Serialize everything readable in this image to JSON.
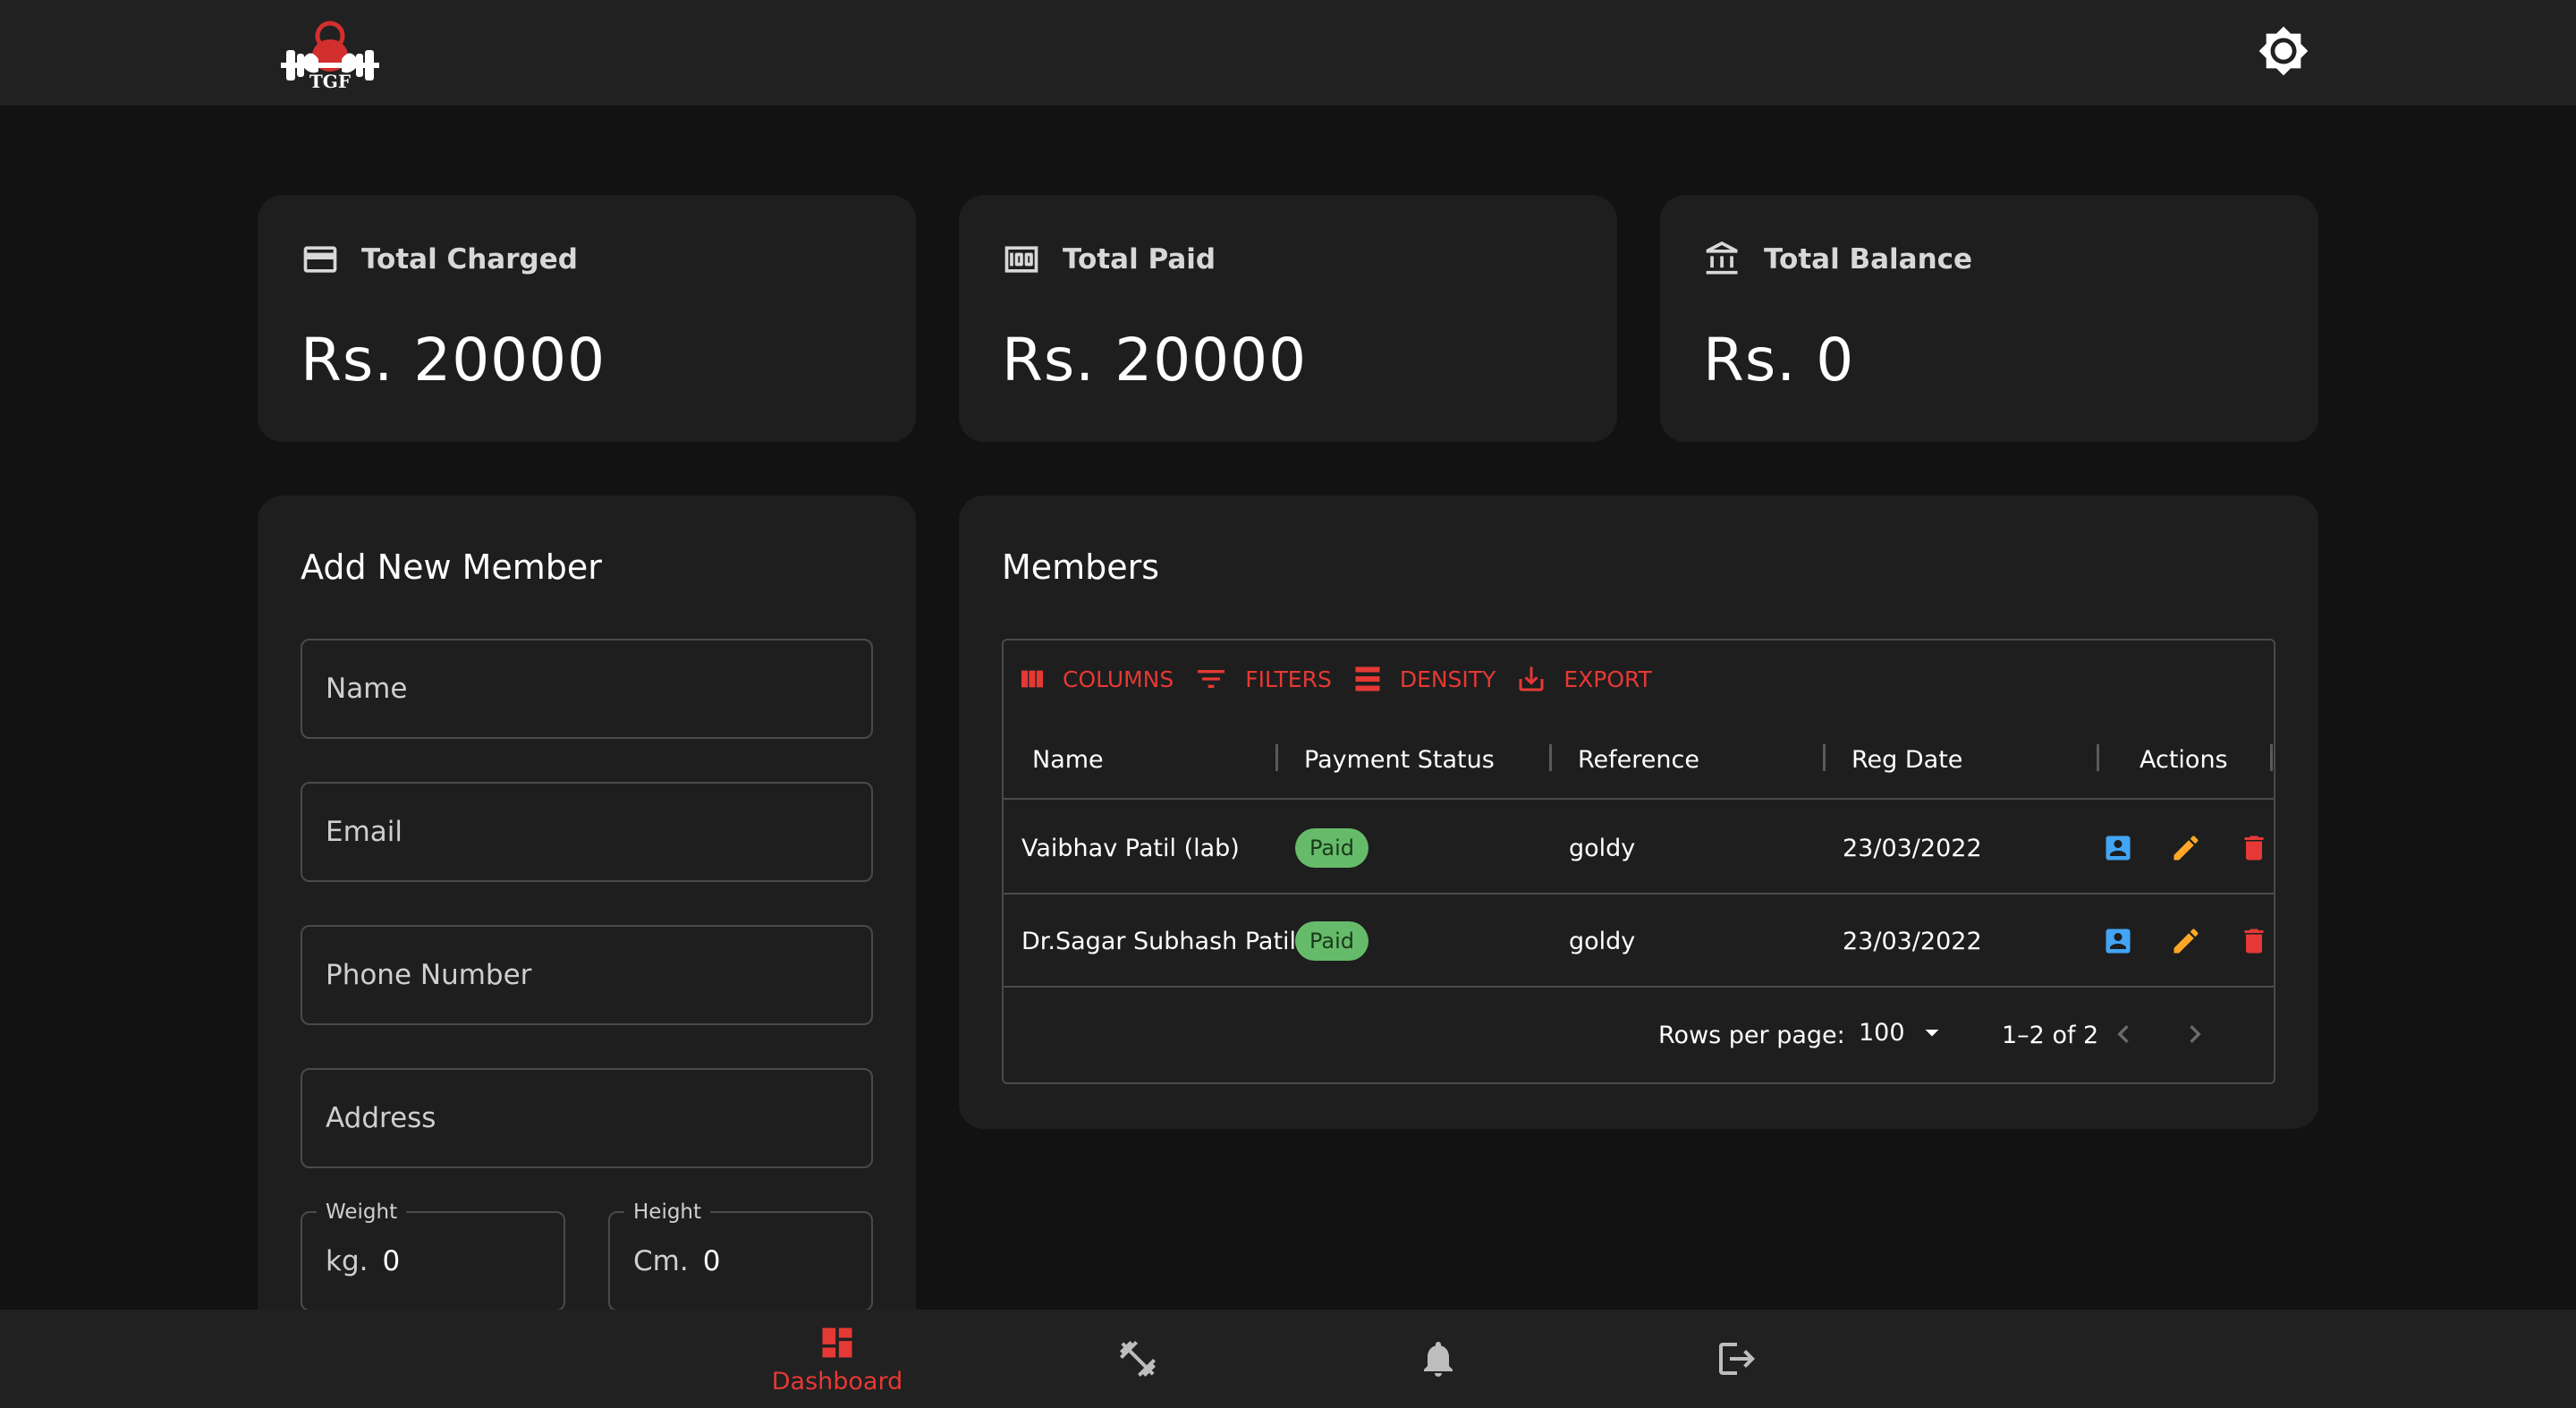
{
  "header": {
    "logo_text": "TGF",
    "theme_toggle": "brightness-icon"
  },
  "stats": [
    {
      "title": "Total Charged",
      "value": "Rs. 20000",
      "icon": "credit-card-icon"
    },
    {
      "title": "Total Paid",
      "value": "Rs. 20000",
      "icon": "money-icon"
    },
    {
      "title": "Total Balance",
      "value": "Rs. 0",
      "icon": "bank-icon"
    }
  ],
  "add_member": {
    "title": "Add New Member",
    "name_placeholder": "Name",
    "email_placeholder": "Email",
    "phone_placeholder": "Phone Number",
    "address_placeholder": "Address",
    "weight": {
      "label": "Weight",
      "unit": "kg.",
      "value": "0"
    },
    "height": {
      "label": "Height",
      "unit": "Cm.",
      "value": "0"
    }
  },
  "members": {
    "title": "Members",
    "toolbar": {
      "columns": "COLUMNS",
      "filters": "FILTERS",
      "density": "DENSITY",
      "export": "EXPORT"
    },
    "columns": [
      "Name",
      "Payment Status",
      "Reference",
      "Reg Date",
      "Actions"
    ],
    "rows": [
      {
        "name": "Vaibhav Patil (lab)",
        "status": "Paid",
        "reference": "goldy",
        "reg_date": "23/03/2022"
      },
      {
        "name": "Dr.Sagar Subhash Patil",
        "status": "Paid",
        "reference": "goldy",
        "reg_date": "23/03/2022"
      }
    ],
    "pagination": {
      "rows_per_page_label": "Rows per page:",
      "rows_per_page": "100",
      "range": "1–2 of 2"
    }
  },
  "bottom_nav": {
    "items": [
      {
        "label": "Dashboard",
        "icon": "dashboard-icon",
        "active": true
      },
      {
        "label": "",
        "icon": "fitness-icon"
      },
      {
        "label": "",
        "icon": "bell-icon"
      },
      {
        "label": "",
        "icon": "logout-icon"
      }
    ]
  },
  "colors": {
    "accent": "#e53935",
    "paid": "#66bb6a",
    "view": "#42a5f5",
    "edit": "#ffa726"
  }
}
